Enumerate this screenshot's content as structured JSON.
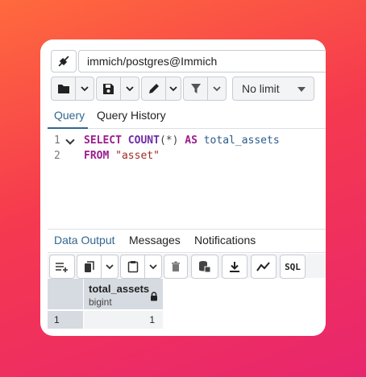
{
  "connection": {
    "label": "immich/postgres@Immich"
  },
  "toolbar": {
    "limit_value": "No limit"
  },
  "editor_tabs": {
    "query": "Query",
    "history": "Query History"
  },
  "editor": {
    "line1_no": "1",
    "line2_no": "2",
    "line1": {
      "k1": "SELECT",
      "fn": "COUNT",
      "p1": "(*)",
      "k2": "AS",
      "id": "total_assets"
    },
    "line2": {
      "k1": "FROM",
      "str": "\"asset\""
    }
  },
  "output_tabs": {
    "data": "Data Output",
    "messages": "Messages",
    "notifications": "Notifications"
  },
  "output_toolbar": {
    "sql_label": "SQL"
  },
  "result": {
    "column_name": "total_assets",
    "column_type": "bigint",
    "rows": [
      {
        "num": "1",
        "value": "1"
      }
    ]
  },
  "colors": {
    "accent": "#326690",
    "keyword": "#9c1d8e",
    "string": "#a12a1e"
  }
}
